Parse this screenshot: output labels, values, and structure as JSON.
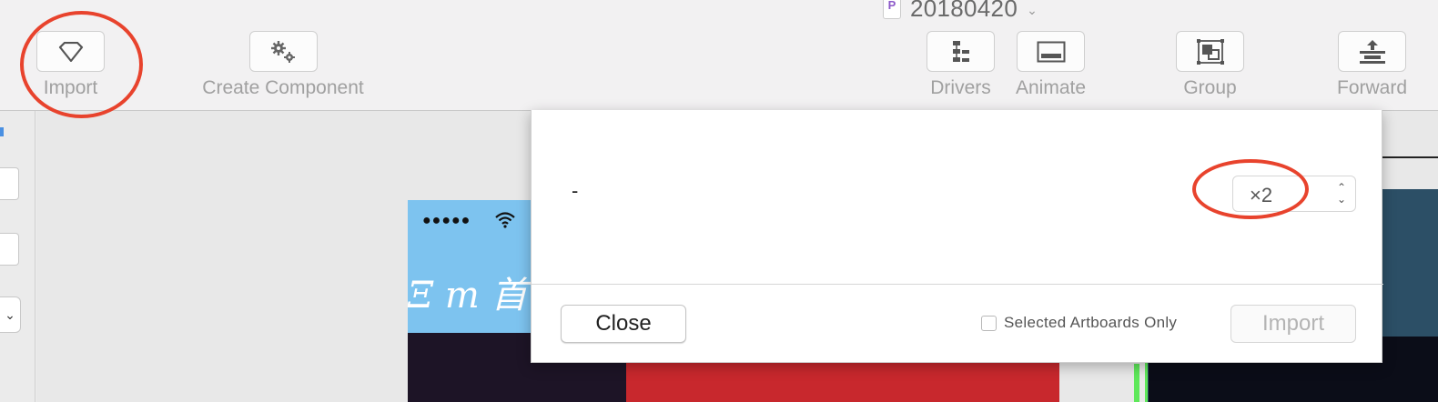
{
  "window": {
    "document_title": "20180420",
    "doc_icon_glyph": "P"
  },
  "toolbar": {
    "import_label": "Import",
    "create_component_label": "Create Component",
    "drivers_label": "Drivers",
    "animate_label": "Animate",
    "group_label": "Group",
    "forward_label": "Forward"
  },
  "artboard": {
    "signal_dots": "●●●●●",
    "logo_text": "Ξ m 首"
  },
  "dialog": {
    "artboard_name": "-",
    "scale_value": "×2",
    "scale_stepper_up": "⌃",
    "scale_stepper_down": "⌄",
    "close_label": "Close",
    "selected_only_label": "Selected Artboards Only",
    "selected_only_checked": false,
    "import_label": "Import"
  },
  "colors": {
    "annotation_red": "#e8432d",
    "artboard_sky": "#7dc3ef",
    "selection_green": "#5ee85a"
  },
  "icons": [
    "sketch-diamond-icon",
    "gears-icon",
    "drivers-icon",
    "animate-icon",
    "group-icon",
    "forward-icon",
    "wifi-icon",
    "document-icon",
    "chevron-down-icon"
  ]
}
